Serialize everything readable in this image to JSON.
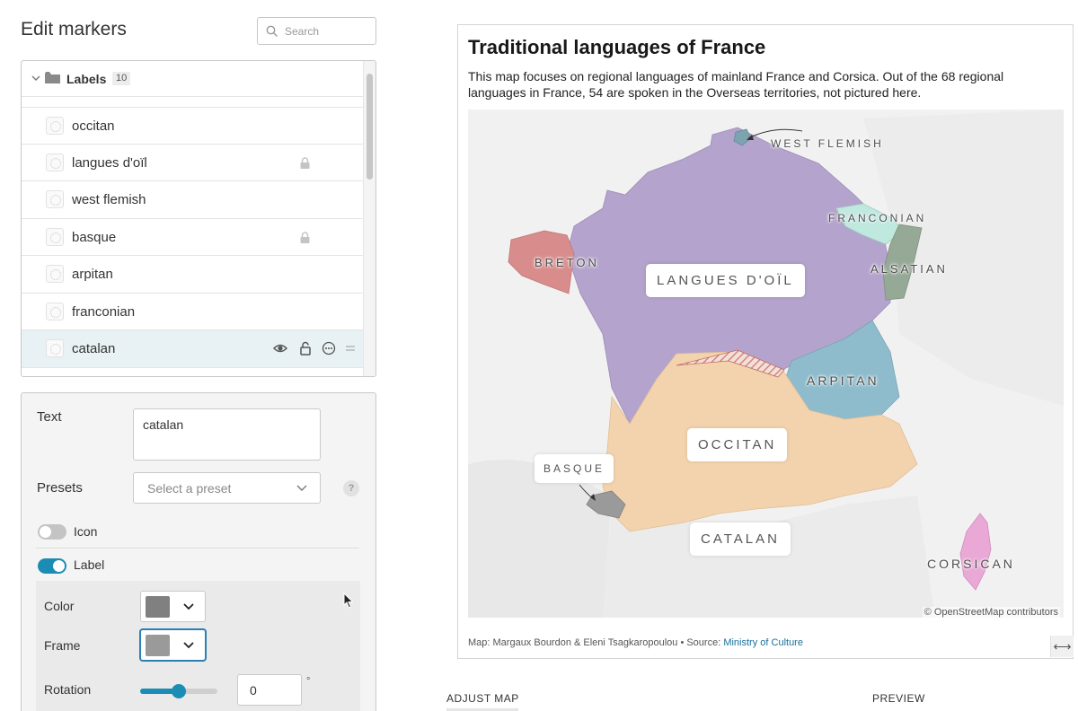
{
  "panel": {
    "title": "Edit markers",
    "search_placeholder": "Search"
  },
  "labels_group": {
    "name": "Labels",
    "count": "10",
    "items": [
      {
        "name": "occitan",
        "locked": false
      },
      {
        "name": "langues d'oïl",
        "locked": true
      },
      {
        "name": "west flemish",
        "locked": false
      },
      {
        "name": "basque",
        "locked": true
      },
      {
        "name": "arpitan",
        "locked": false
      },
      {
        "name": "franconian",
        "locked": false
      },
      {
        "name": "catalan",
        "locked": false,
        "selected": true
      }
    ]
  },
  "properties": {
    "text_label": "Text",
    "text_value": "catalan",
    "presets_label": "Presets",
    "presets_placeholder": "Select a preset",
    "help": "?",
    "icon_label": "Icon",
    "icon_enabled": false,
    "label_label": "Label",
    "label_enabled": true,
    "color_label": "Color",
    "color_value": "#808080",
    "frame_label": "Frame",
    "frame_value": "#9a9a9a",
    "rotation_label": "Rotation",
    "rotation_value": "0",
    "rotation_unit": "°"
  },
  "map_card": {
    "title": "Traditional languages of France",
    "description": "This map focuses on regional languages of mainland France and Corsica. Out of the 68 regional languages in France, 54 are spoken in the Overseas territories, not pictured here.",
    "attribution": "© OpenStreetMap contributors",
    "footer_prefix": "Map: Margaux Bourdon & Eleni Tsagkaropoulou • Source: ",
    "footer_source": "Ministry of Culture",
    "resize_glyph": "⟷",
    "regions": {
      "langues_doil": "#b4a3cc",
      "occitan": "#f2d3ad",
      "breton": "#d98c8c",
      "arpitan": "#8fbccc",
      "alsatian": "#96a896",
      "franconian": "#bfe8df",
      "basque": "#9a9a9a",
      "corsican": "#e9a8d6",
      "west_flemish": "#7ea3b0",
      "catalan_hatch": "#d4867e"
    },
    "map_labels": {
      "west_flemish": "WEST FLEMISH",
      "franconian": "FRANCONIAN",
      "alsatian": "ALSATIAN",
      "breton": "BRETON",
      "langues_doil": "LANGUES D'OÏL",
      "arpitan": "ARPITAN",
      "occitan": "OCCITAN",
      "basque": "BASQUE",
      "catalan": "CATALAN",
      "corsican": "CORSICAN"
    }
  },
  "bottom_tabs": {
    "adjust": "ADJUST MAP",
    "preview": "PREVIEW"
  }
}
